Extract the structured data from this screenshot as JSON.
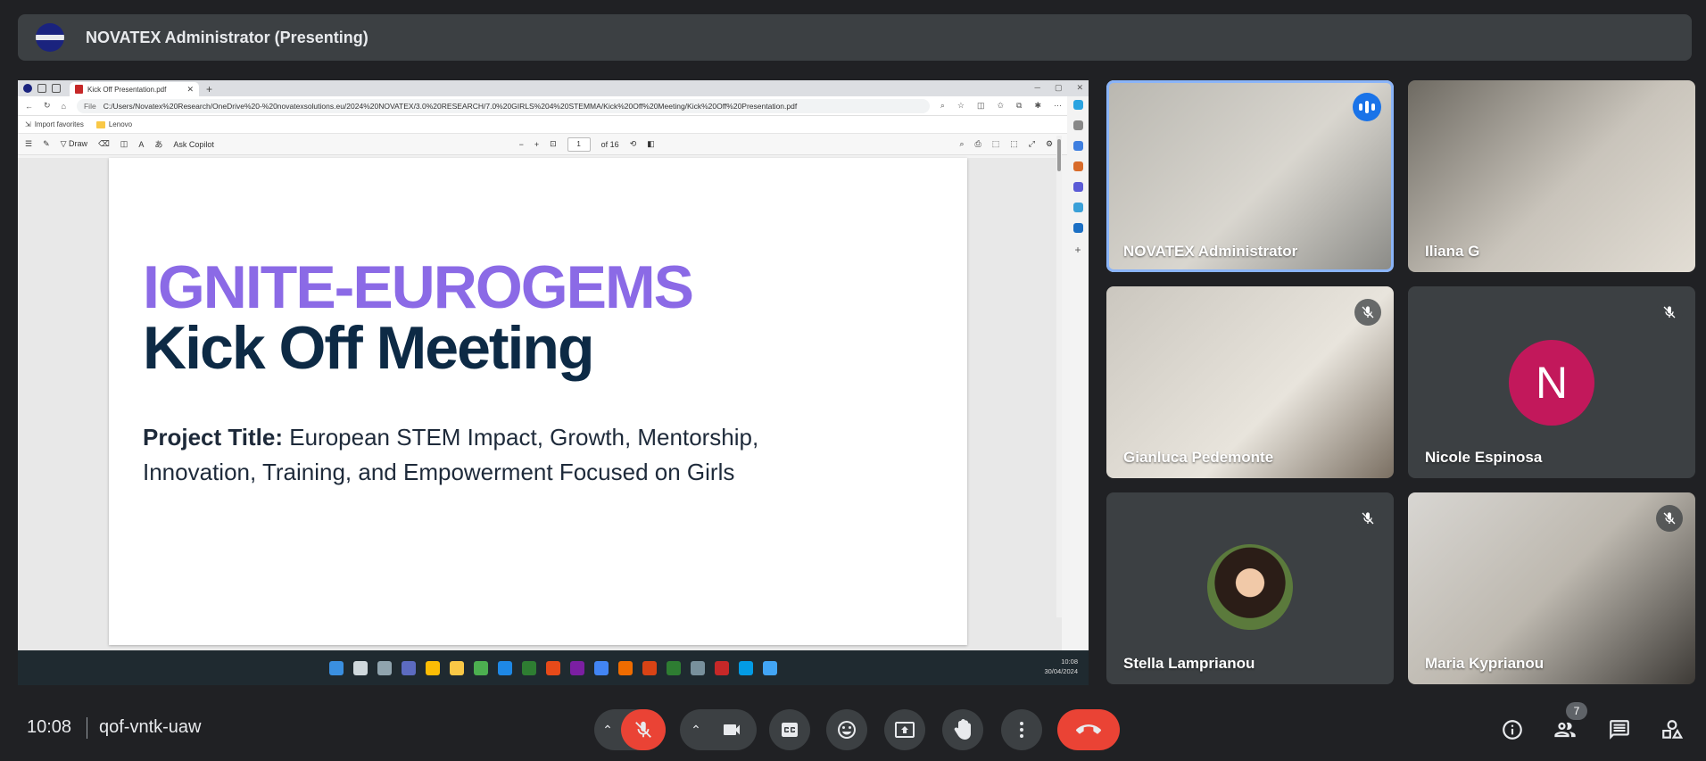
{
  "presenter_bar": {
    "title": "NOVATEX Administrator (Presenting)"
  },
  "browser": {
    "tab_title": "Kick Off Presentation.pdf",
    "new_tab": "+",
    "tab_close": "✕",
    "url_scheme": "File",
    "url": "C:/Users/Novatex%20Research/OneDrive%20-%20novatexsolutions.eu/2024%20NOVATEX/3.0%20RESEARCH/7.0%20GIRLS%204%20STEMMA/Kick%20Off%20Meeting/Kick%20Off%20Presentation.pdf",
    "favorites": [
      "Import favorites",
      "Lenovo"
    ],
    "pdf_toolbar": {
      "draw": "Draw",
      "copilot": "Ask Copilot",
      "page": "1",
      "page_total": "of 16"
    }
  },
  "slide": {
    "heading1": "IGNITE-EUROGEMS",
    "heading2": "Kick Off Meeting",
    "label": "Project Title:",
    "body": " European STEM Impact, Growth, Mentorship, Innovation, Training, and Empowerment Focused on Girls"
  },
  "taskbar": {
    "time": "10:08",
    "date": "30/04/2024"
  },
  "participants": [
    {
      "name": "NOVATEX Administrator",
      "state": "speaking"
    },
    {
      "name": "Iliana G",
      "state": "unmuted"
    },
    {
      "name": "Gianluca Pedemonte",
      "state": "muted"
    },
    {
      "name": "Nicole Espinosa",
      "state": "muted",
      "initial": "N"
    },
    {
      "name": "Stella Lamprianou",
      "state": "muted"
    },
    {
      "name": "Maria Kyprianou",
      "state": "muted"
    }
  ],
  "meeting": {
    "time": "10:08",
    "code": "qof-vntk-uaw",
    "participant_count": "7"
  },
  "colors": {
    "end_call": "#ea4335",
    "accent": "#8ab4f8",
    "avatar_n": "#c2185b"
  }
}
